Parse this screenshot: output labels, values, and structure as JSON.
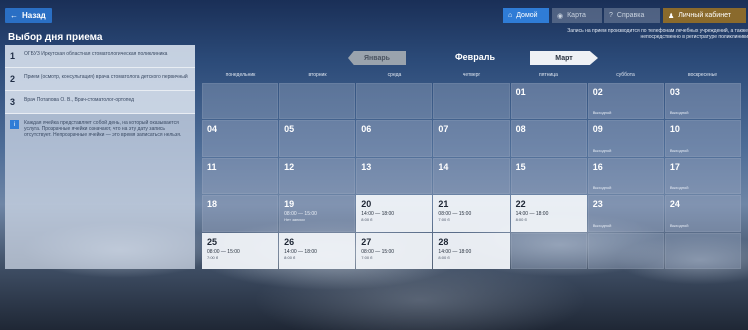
{
  "topbar": {
    "back_label": "Назад",
    "home_label": "Домой",
    "map_label": "Карта",
    "help_label": "Справка",
    "cabinet_label": "Личный кабинет"
  },
  "page": {
    "title": "Выбор дня приема",
    "notice": "Запись на прием производится по телефонам лечебных учреждений, а также непосредственно в регистратуре поликлиники"
  },
  "steps": [
    {
      "num": "1",
      "text": "ОГБУЗ Иркутская областная стоматологическая поликлиника"
    },
    {
      "num": "2",
      "text": "Прием (осмотр, консультация) врача стоматолога детского первичный"
    },
    {
      "num": "3",
      "text": "Врач Потапова О. В., Врач-стоматолог-ортопед"
    }
  ],
  "hint": {
    "icon": "info-icon",
    "text": "Каждая ячейка представляет собой день, на который оказывается услуга. Прозрачные ячейки означают, что на эту дату запись отсутствует. Непрозрачные ячейки — это время записаться нельзя."
  },
  "calendar": {
    "prev_month": "Январь",
    "current_month": "Февраль",
    "next_month": "Март",
    "weekdays": [
      "понедельник",
      "вторник",
      "среда",
      "четверг",
      "пятница",
      "суббота",
      "воскресенье"
    ],
    "cells": [
      {
        "day": "",
        "type": "empty"
      },
      {
        "day": "",
        "type": "empty"
      },
      {
        "day": "",
        "type": "empty"
      },
      {
        "day": "",
        "type": "empty"
      },
      {
        "day": "01",
        "type": "past",
        "status": ""
      },
      {
        "day": "02",
        "type": "past",
        "status": "Выходной"
      },
      {
        "day": "03",
        "type": "past",
        "status": "Выходной"
      },
      {
        "day": "04",
        "type": "past",
        "status": ""
      },
      {
        "day": "05",
        "type": "past",
        "status": ""
      },
      {
        "day": "06",
        "type": "past",
        "status": ""
      },
      {
        "day": "07",
        "type": "past",
        "status": ""
      },
      {
        "day": "08",
        "type": "past",
        "status": ""
      },
      {
        "day": "09",
        "type": "past",
        "status": "Выходной"
      },
      {
        "day": "10",
        "type": "past",
        "status": "Выходной"
      },
      {
        "day": "11",
        "type": "past",
        "status": ""
      },
      {
        "day": "12",
        "type": "past",
        "status": ""
      },
      {
        "day": "13",
        "type": "past",
        "status": ""
      },
      {
        "day": "14",
        "type": "past",
        "status": ""
      },
      {
        "day": "15",
        "type": "past",
        "status": ""
      },
      {
        "day": "16",
        "type": "past",
        "status": "Выходной"
      },
      {
        "day": "17",
        "type": "past",
        "status": "Выходной"
      },
      {
        "day": "18",
        "type": "past",
        "status": ""
      },
      {
        "day": "19",
        "type": "past",
        "status": "",
        "time": "08:00 — 15:00",
        "sub": "Нет записи"
      },
      {
        "day": "20",
        "type": "active",
        "status": "",
        "time": "14:00 — 18:00",
        "sub": "8:00 б"
      },
      {
        "day": "21",
        "type": "active",
        "status": "",
        "time": "08:00 — 15:00",
        "sub": "7:00 б"
      },
      {
        "day": "22",
        "type": "active",
        "status": "",
        "time": "14:00 — 18:00",
        "sub": "8:00 б"
      },
      {
        "day": "23",
        "type": "past",
        "status": "Выходной"
      },
      {
        "day": "24",
        "type": "past",
        "status": "Выходной"
      },
      {
        "day": "25",
        "type": "active",
        "status": "",
        "time": "08:00 — 15:00",
        "sub": "7:00 б"
      },
      {
        "day": "26",
        "type": "active",
        "status": "",
        "time": "14:00 — 18:00",
        "sub": "8:00 б"
      },
      {
        "day": "27",
        "type": "active",
        "status": "",
        "time": "08:00 — 15:00",
        "sub": "7:00 б"
      },
      {
        "day": "28",
        "type": "active",
        "status": "",
        "time": "14:00 — 18:00",
        "sub": "8:00 б"
      },
      {
        "day": "",
        "type": "empty"
      },
      {
        "day": "",
        "type": "empty"
      },
      {
        "day": "",
        "type": "empty"
      }
    ]
  }
}
